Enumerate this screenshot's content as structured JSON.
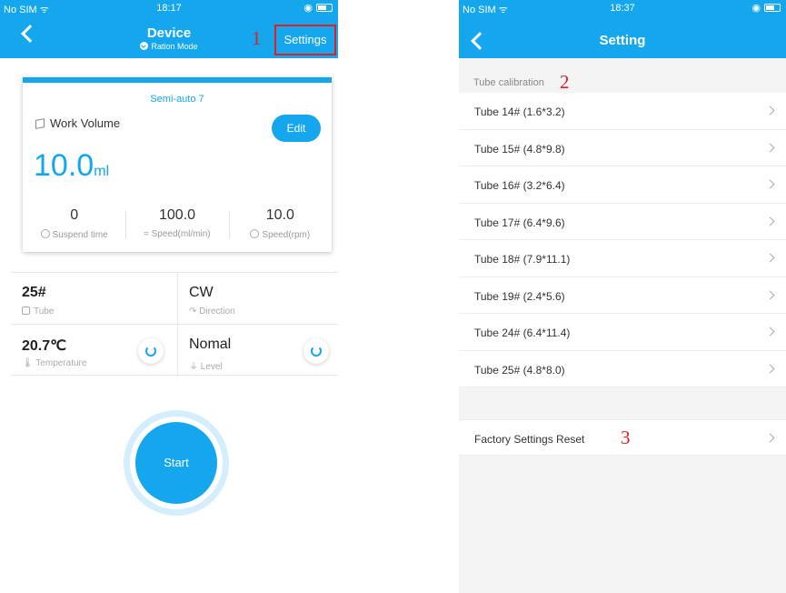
{
  "left": {
    "status": {
      "carrier": "No SIM",
      "time": "18:17"
    },
    "nav": {
      "title": "Device",
      "mode": "Ration Mode",
      "settings_label": "Settings"
    },
    "annotation": "1",
    "card": {
      "mode": "Semi-auto 7",
      "work_volume_label": "Work Volume",
      "edit_label": "Edit",
      "volume_value": "10.0",
      "volume_unit": "ml",
      "stats": [
        {
          "value": "0",
          "label": "Suspend time"
        },
        {
          "value": "100.0",
          "label": "Speed(ml/min)"
        },
        {
          "value": "10.0",
          "label": "Speed(rpm)"
        }
      ]
    },
    "grid": {
      "tube_value": "25#",
      "tube_label": "Tube",
      "direction_value": "CW",
      "direction_label": "Direction",
      "temperature_value": "20.7℃",
      "temperature_label": "Temperature",
      "level_value": "Nomal",
      "level_label": "Level"
    },
    "start_label": "Start"
  },
  "right": {
    "status": {
      "carrier": "No SIM",
      "time": "18:37"
    },
    "nav": {
      "title": "Setting"
    },
    "section_label": "Tube calibration",
    "annotation_section": "2",
    "tubes": [
      "Tube  14# (1.6*3.2)",
      "Tube  15# (4.8*9.8)",
      "Tube  16# (3.2*6.4)",
      "Tube  17# (6.4*9.6)",
      "Tube  18# (7.9*11.1)",
      "Tube  19# (2.4*5.6)",
      "Tube  24# (6.4*11.4)",
      "Tube  25# (4.8*8.0)"
    ],
    "reset_label": "Factory Settings Reset",
    "annotation_reset": "3"
  },
  "colors": {
    "accent": "#14a7ee",
    "annotation": "#e21e25"
  }
}
